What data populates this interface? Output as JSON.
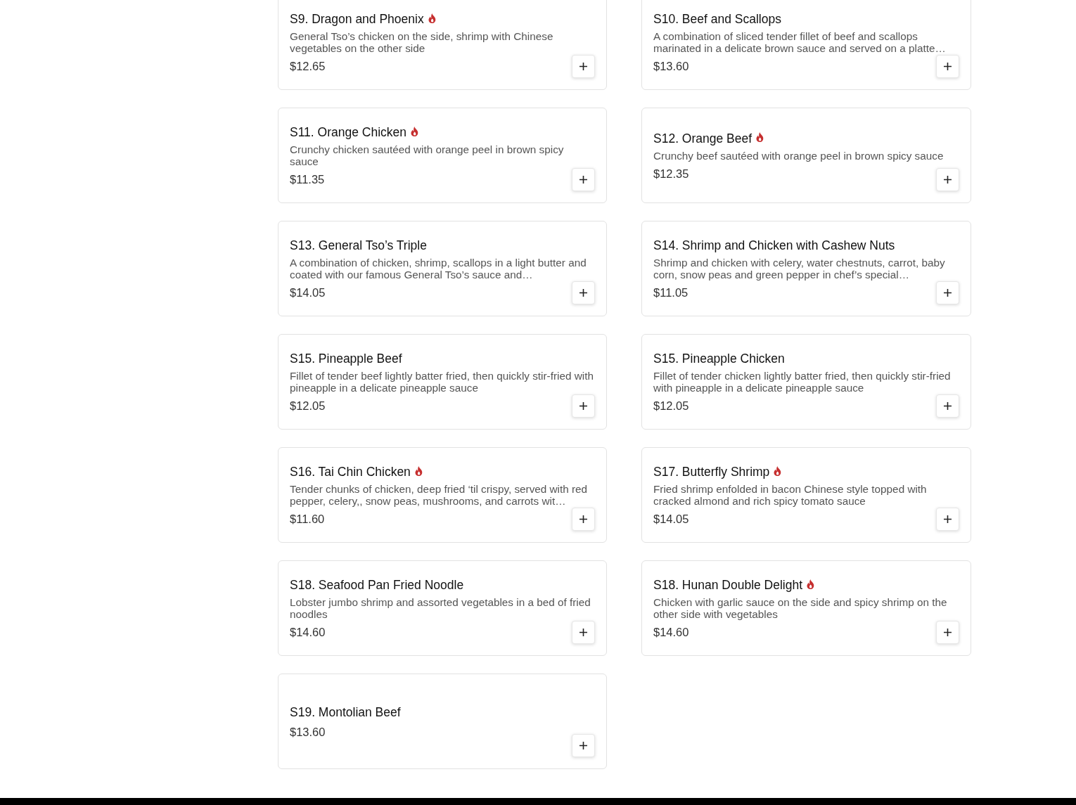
{
  "menu_items": [
    {
      "name": "S9. Dragon and Phoenix",
      "spicy": true,
      "description": "General Tso’s chicken on the side, shrimp with Chinese vegetables on the other side",
      "price": "$12.65"
    },
    {
      "name": "S10. Beef and Scallops",
      "spicy": false,
      "description": "A combination of sliced tender fillet of beef and scallops marinated in a delicate brown sauce and served on a platte…",
      "price": "$13.60"
    },
    {
      "name": "S11. Orange Chicken",
      "spicy": true,
      "description": "Crunchy chicken sautéed with orange peel in brown spicy sauce",
      "price": "$11.35"
    },
    {
      "name": "S12. Orange Beef",
      "spicy": true,
      "description": "Crunchy beef sautéed with orange peel in brown spicy sauce",
      "price": "$12.35"
    },
    {
      "name": "S13. General Tso’s Triple",
      "spicy": false,
      "description": "A combination of chicken, shrimp, scallops in a light butter and coated with our famous General Tso’s sauce and…",
      "price": "$14.05"
    },
    {
      "name": "S14. Shrimp and Chicken with Cashew Nuts",
      "spicy": false,
      "description": "Shrimp and chicken with celery, water chestnuts, carrot, baby corn, snow peas and green pepper in chef’s special…",
      "price": "$11.05"
    },
    {
      "name": "S15. Pineapple Beef",
      "spicy": false,
      "description": "Fillet of tender beef lightly batter fried, then quickly stir-fried with pineapple in a delicate pineapple sauce",
      "price": "$12.05"
    },
    {
      "name": "S15. Pineapple Chicken",
      "spicy": false,
      "description": "Fillet of tender chicken lightly batter fried, then quickly stir-fried with pineapple in a delicate pineapple sauce",
      "price": "$12.05"
    },
    {
      "name": "S16. Tai Chin Chicken",
      "spicy": true,
      "description": "Tender chunks of chicken, deep fried ‘til crispy, served with red pepper, celery,, snow peas, mushrooms, and carrots wit…",
      "price": "$11.60"
    },
    {
      "name": "S17. Butterfly Shrimp",
      "spicy": true,
      "description": "Fried shrimp enfolded in bacon Chinese style topped with cracked almond and rich spicy tomato sauce",
      "price": "$14.05"
    },
    {
      "name": "S18. Seafood Pan Fried Noodle",
      "spicy": false,
      "description": "Lobster jumbo shrimp and assorted vegetables in a bed of fried noodles",
      "price": "$14.60"
    },
    {
      "name": "S18. Hunan Double Delight",
      "spicy": true,
      "description": "Chicken with garlic sauce on the side and spicy shrimp on the other side with vegetables",
      "price": "$14.60"
    },
    {
      "name": "S19. Montolian Beef",
      "spicy": false,
      "price": "$13.60"
    }
  ]
}
